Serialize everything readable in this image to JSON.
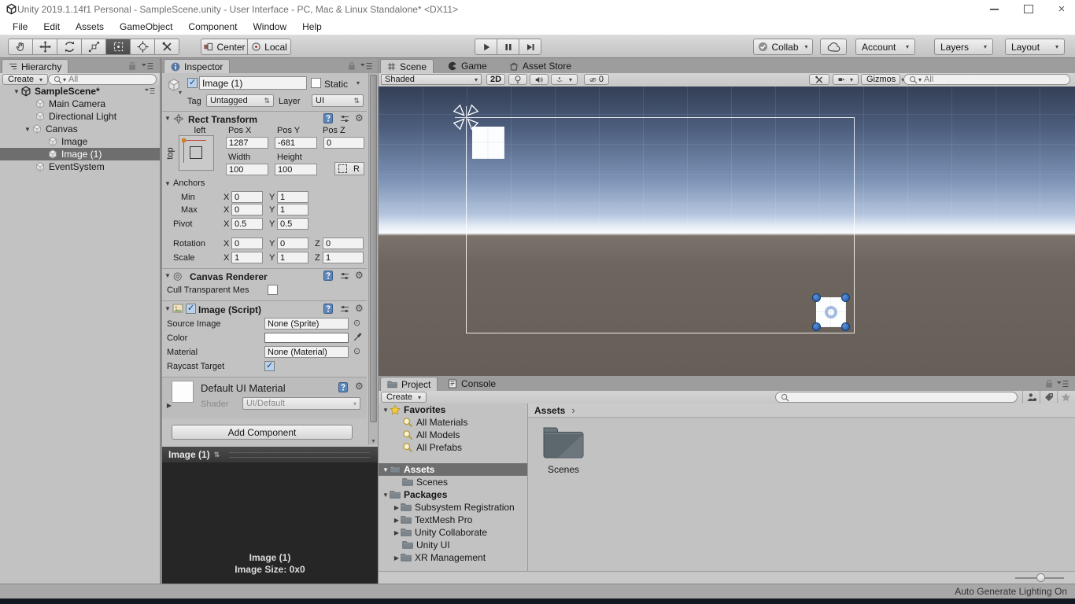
{
  "window": {
    "title": "Unity 2019.1.14f1 Personal - SampleScene.unity - User Interface - PC, Mac & Linux Standalone* <DX11>",
    "close_glyph": "×"
  },
  "menu": {
    "items": [
      "File",
      "Edit",
      "Assets",
      "GameObject",
      "Component",
      "Window",
      "Help"
    ]
  },
  "toolbar": {
    "pivot_center": "Center",
    "pivot_local": "Local",
    "collab_label": "Collab",
    "account_label": "Account",
    "layers_label": "Layers",
    "layout_label": "Layout"
  },
  "hierarchy": {
    "tab_label": "Hierarchy",
    "create_label": "Create",
    "search_text": "All",
    "items": [
      {
        "label": "SampleScene*"
      },
      {
        "label": "Main Camera"
      },
      {
        "label": "Directional Light"
      },
      {
        "label": "Canvas"
      },
      {
        "label": "Image"
      },
      {
        "label": "Image (1)"
      },
      {
        "label": "EventSystem"
      }
    ]
  },
  "inspector": {
    "tab_label": "Inspector",
    "name_value": "Image (1)",
    "static_label": "Static",
    "tag_label": "Tag",
    "tag_value": "Untagged",
    "layer_label": "Layer",
    "layer_value": "UI",
    "rect_transform": {
      "title": "Rect Transform",
      "anchor_left_text": "left",
      "anchor_top_text": "top",
      "pos_x_label": "Pos X",
      "pos_y_label": "Pos Y",
      "pos_z_label": "Pos Z",
      "pos_x": "1287",
      "pos_y": "-681",
      "pos_z": "0",
      "width_label": "Width",
      "height_label": "Height",
      "width": "100",
      "height": "100",
      "r_button_label": "R",
      "anchors_label": "Anchors",
      "min_label": "Min",
      "max_label": "Max",
      "pivot_label": "Pivot",
      "rotation_label": "Rotation",
      "scale_label": "Scale",
      "x": "X",
      "y": "Y",
      "z": "Z",
      "min_x": "0",
      "min_y": "1",
      "max_x": "0",
      "max_y": "1",
      "pivot_x": "0.5",
      "pivot_y": "0.5",
      "rotation_x": "0",
      "rotation_y": "0",
      "rotation_z": "0",
      "scale_x": "1",
      "scale_y": "1",
      "scale_z": "1"
    },
    "canvas_renderer": {
      "title": "Canvas Renderer",
      "cull_label": "Cull Transparent Mes"
    },
    "image_component": {
      "title": "Image (Script)",
      "source_image_label": "Source Image",
      "source_image_value": "None (Sprite)",
      "color_label": "Color",
      "material_label": "Material",
      "material_value": "None (Material)",
      "raycast_label": "Raycast Target"
    },
    "material_preview": {
      "title": "Default UI Material",
      "shader_label": "Shader",
      "shader_value": "UI/Default"
    },
    "add_component_label": "Add Component",
    "preview": {
      "tab_label": "Image (1)",
      "name": "Image (1)",
      "size": "Image Size: 0x0"
    }
  },
  "scene_view": {
    "tabs": [
      "Scene",
      "Game",
      "Asset Store"
    ],
    "shading_mode": "Shaded",
    "mode_2d_label": "2D",
    "hidden_count": "0",
    "gizmos_label": "Gizmos",
    "search_text": "All"
  },
  "project": {
    "tab_project": "Project",
    "tab_console": "Console",
    "create_label": "Create",
    "tree": {
      "favorites_label": "Favorites",
      "favorites": [
        "All Materials",
        "All Models",
        "All Prefabs"
      ],
      "assets_label": "Assets",
      "assets_children": [
        "Scenes"
      ],
      "packages_label": "Packages",
      "packages_children": [
        "Subsystem Registration",
        "TextMesh Pro",
        "Unity Collaborate",
        "Unity UI",
        "XR Management"
      ]
    },
    "breadcrumb": "Assets",
    "folder_item_label": "Scenes"
  },
  "status_bar": {
    "lighting_status": "Auto Generate Lighting On"
  },
  "glyphs": {
    "caret": "▾",
    "fold_open": "▼",
    "fold_closed": "▶",
    "gear": "⚙",
    "picker": "⊙",
    "canvas_renderer_icon": "◎",
    "breadcrumb_sep": "›",
    "updown": "⇅",
    "close": "×"
  },
  "colors": {
    "selection_gray": "#6e6e6e",
    "handle_blue": "#2e6bbd",
    "sky_top": "#333f55",
    "ground": "#6e655e",
    "panel": "#c2c2c2"
  }
}
